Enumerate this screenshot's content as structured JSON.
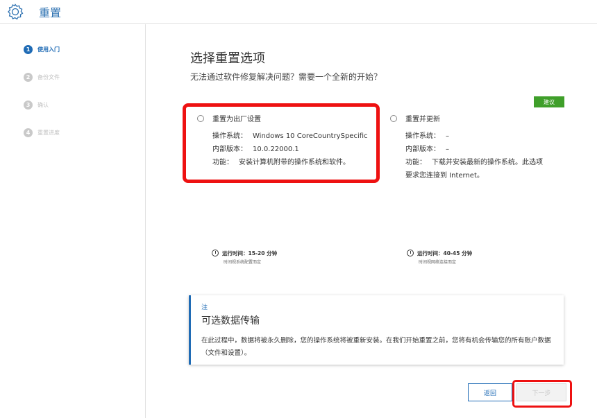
{
  "header": {
    "title": "重置",
    "icon": "gear-icon",
    "accent_color": "#2a6fb0"
  },
  "sidebar": {
    "steps": [
      {
        "num": "1",
        "label": "使用入门",
        "active": true
      },
      {
        "num": "2",
        "label": "备份文件",
        "active": false
      },
      {
        "num": "3",
        "label": "确认",
        "active": false
      },
      {
        "num": "4",
        "label": "重置进度",
        "active": false
      }
    ]
  },
  "main": {
    "title": "选择重置选项",
    "subtitle": "无法通过软件修复解决问题？需要一个全新的开始？",
    "recommend_badge": "建议",
    "options": [
      {
        "title": "重置为出厂设置",
        "os_label": "操作系统：",
        "os_value": "Windows 10 CoreCountrySpecific",
        "build_label": "内部版本：",
        "build_value": "10.0.22000.1",
        "feature_label": "功能：",
        "feature_value": "安装计算机附带的操作系统和软件。",
        "runtime": "运行时间：15-20 分钟",
        "runtime_note": "时间视系统配置而定"
      },
      {
        "title": "重置并更新",
        "os_label": "操作系统：",
        "os_value": "–",
        "build_label": "内部版本：",
        "build_value": "–",
        "feature_label": "功能：",
        "feature_value": "下载并安装最新的操作系统。此选项",
        "feature_value_2": "要求您连接到 Internet。",
        "runtime": "运行时间：40-45 分钟",
        "runtime_note": "时间视网络连接而定"
      }
    ],
    "note": {
      "tag": "注",
      "title": "可选数据传输",
      "body": "在此过程中，数据将被永久删除，您的操作系统将被重新安装。在我们开始重置之前，您将有机会传输您的所有账户数据（文件和设置）。"
    },
    "buttons": {
      "back": "返回",
      "next": "下一步"
    }
  },
  "colors": {
    "primary": "#1f6bb5",
    "badge": "#3f9f2a",
    "highlight": "#ee1111"
  }
}
